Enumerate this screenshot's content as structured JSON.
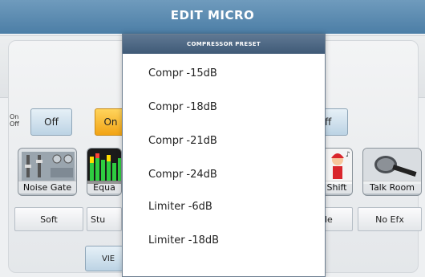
{
  "window": {
    "title": "EDIT MICRO"
  },
  "controls": {
    "onoff_label_on": "On",
    "onoff_label_off": "Off",
    "off_button": "Off",
    "on_button": "On",
    "off_button_2": "ff"
  },
  "effects": [
    {
      "label": "Noise Gate",
      "icon": "noise-gate-icon"
    },
    {
      "label": "Equa",
      "icon": "equalizer-icon"
    },
    {
      "label": "Shift",
      "icon": "pitch-shift-icon"
    },
    {
      "label": "Talk Room",
      "icon": "microphone-icon"
    }
  ],
  "presets": {
    "soft": "Soft",
    "stu": "Stu",
    "le": "le",
    "no_efx": "No Efx"
  },
  "view_button": "VIE",
  "popup": {
    "title": "COMPRESSOR PRESET",
    "items": [
      "Compr -15dB",
      "Compr -18dB",
      "Compr -21dB",
      "Compr -24dB",
      "Limiter -6dB",
      "Limiter -18dB"
    ]
  },
  "colors": {
    "title_bar": "#5a89b0",
    "active_button": "#f5b020",
    "popup_header": "#4a6482"
  }
}
